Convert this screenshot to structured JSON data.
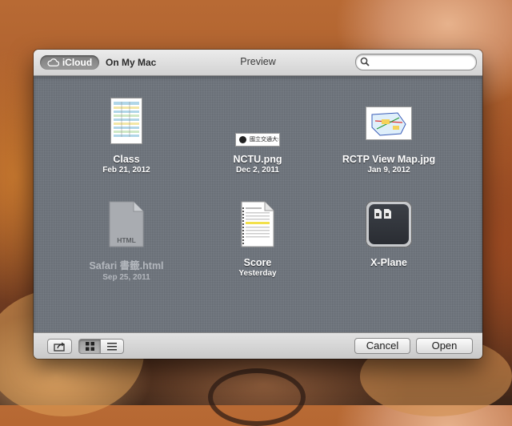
{
  "toolbar": {
    "icloud_label": "iCloud",
    "mymac_label": "On My Mac",
    "title": "Preview",
    "search": {
      "placeholder": "",
      "value": ""
    }
  },
  "files": [
    {
      "name": "Class",
      "date": "Feb 21, 2012",
      "icon": "spreadsheet-thumbnail"
    },
    {
      "name": "NCTU.png",
      "date": "Dec 2, 2011",
      "icon": "banner-image-thumbnail",
      "thumb_text": "國立交通大學"
    },
    {
      "name": "RCTP View Map.jpg",
      "date": "Jan 9, 2012",
      "icon": "map-thumbnail"
    },
    {
      "name": "Safari 書籤.html",
      "date": "Sep 25, 2011",
      "icon": "html-document-icon",
      "thumb_text": "HTML"
    },
    {
      "name": "Score",
      "date": "Yesterday",
      "icon": "spreadsheet-thumbnail"
    },
    {
      "name": "X-Plane",
      "date": "",
      "icon": "folder-thumbnail"
    }
  ],
  "bottom": {
    "cancel_label": "Cancel",
    "open_label": "Open",
    "view_mode": "grid"
  },
  "colors": {
    "content_bg": "#6f757d",
    "toolbar_bg": "#dcdcdc"
  }
}
